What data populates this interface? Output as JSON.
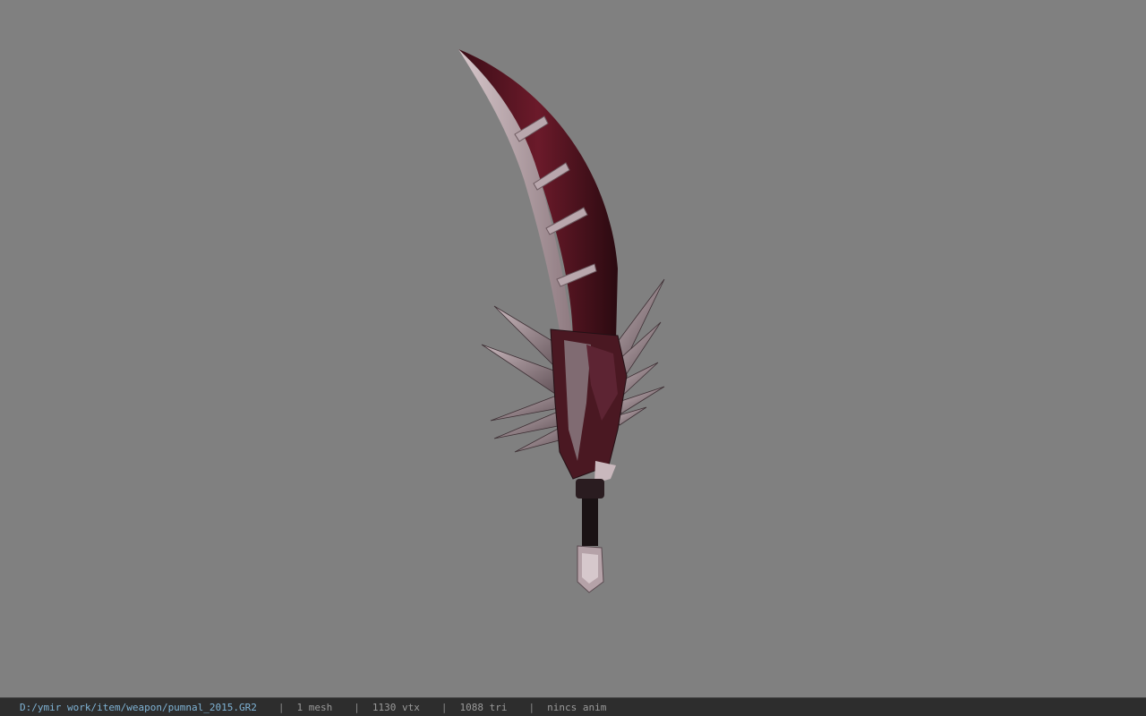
{
  "viewer": {
    "background_color": "#808080",
    "model_icon": "curved-dagger-model"
  },
  "status": {
    "path": "D:/ymir work/item/weapon/pumnal_2015.GR2",
    "separator": "|",
    "mesh": "1 mesh",
    "vtx": "1130 vtx",
    "tri": "1088 tri",
    "anim": "nincs anim"
  }
}
